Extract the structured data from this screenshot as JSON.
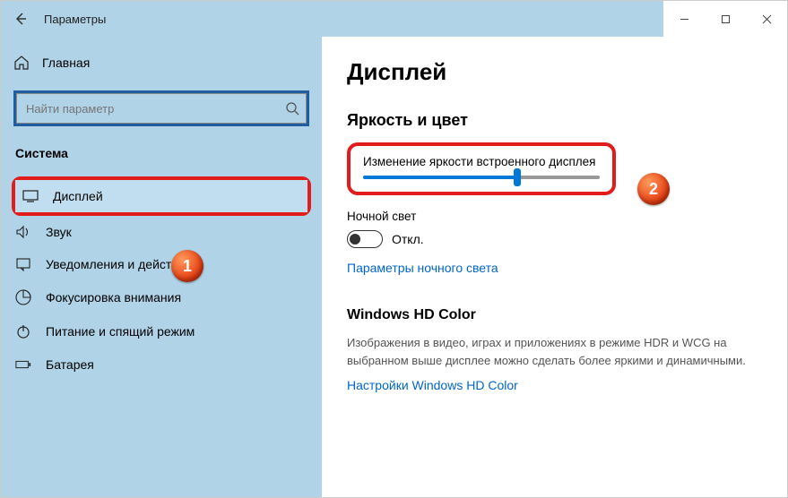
{
  "titlebar": {
    "title": "Параметры"
  },
  "sidebar": {
    "home": "Главная",
    "search_placeholder": "Найти параметр",
    "section": "Система",
    "items": [
      {
        "label": "Дисплей"
      },
      {
        "label": "Звук"
      },
      {
        "label": "Уведомления и действия"
      },
      {
        "label": "Фокусировка внимания"
      },
      {
        "label": "Питание и спящий режим"
      },
      {
        "label": "Батарея"
      }
    ]
  },
  "main": {
    "heading": "Дисплей",
    "section1": "Яркость и цвет",
    "brightness_label": "Изменение яркости встроенного дисплея",
    "brightness_percent": 65,
    "night_light_label": "Ночной свет",
    "toggle_state": "Откл.",
    "night_light_link": "Параметры ночного света",
    "hd_heading": "Windows HD Color",
    "hd_description": "Изображения в видео, играх и приложениях в режиме HDR и WCG на выбранном выше дисплее можно сделать более яркими и динамичными.",
    "hd_link": "Настройки Windows HD Color"
  },
  "badges": {
    "one": "1",
    "two": "2"
  }
}
